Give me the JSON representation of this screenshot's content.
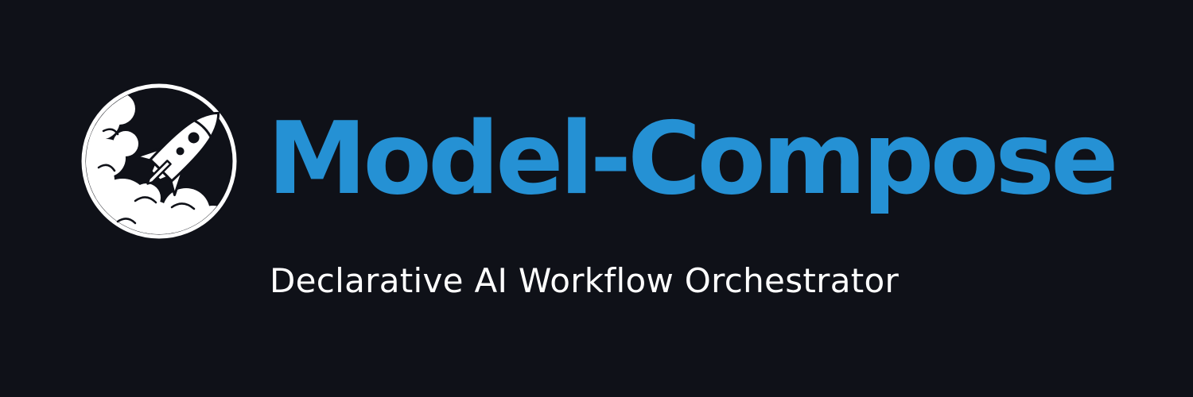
{
  "brand": {
    "name": "Model-Compose",
    "tagline": "Declarative AI Workflow Orchestrator",
    "logo_icon": "rocket-launch-icon"
  },
  "colors": {
    "background": "#0f1118",
    "title": "#2591d4",
    "tagline": "#ffffff",
    "logo": "#ffffff"
  }
}
